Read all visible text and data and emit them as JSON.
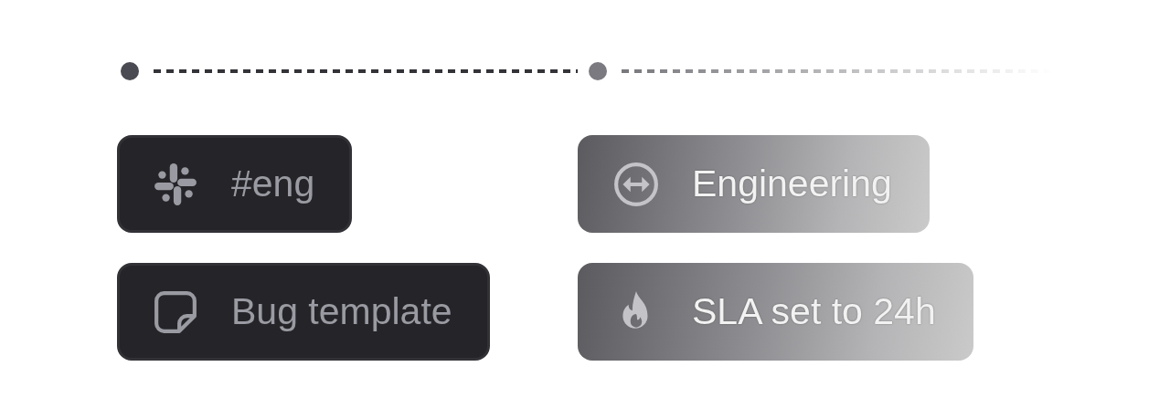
{
  "columns": [
    {
      "faded": false,
      "chips": [
        {
          "kind": "slack",
          "label": "#eng"
        },
        {
          "kind": "note",
          "label": "Bug template"
        }
      ]
    },
    {
      "faded": true,
      "chips": [
        {
          "kind": "arrows",
          "label": "Engineering"
        },
        {
          "kind": "flame",
          "label": "SLA set to 24h"
        }
      ]
    }
  ]
}
